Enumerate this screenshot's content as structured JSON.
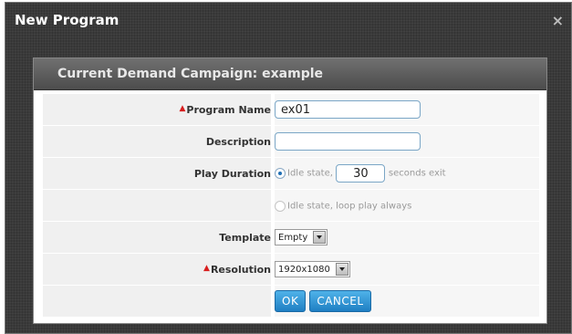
{
  "dialog": {
    "title": "New Program",
    "close_label": "×"
  },
  "panel": {
    "title": "Current Demand Campaign: example"
  },
  "form": {
    "required_marker": "▲",
    "program_name_label": "Program Name",
    "program_name_value": "ex01",
    "description_label": "Description",
    "description_value": "",
    "play_duration_label": "Play Duration",
    "idle_state_label": "Idle state,",
    "idle_seconds_value": "30",
    "seconds_exit_label": "seconds exit",
    "loop_play_label": "Idle state, loop play always",
    "template_label": "Template",
    "template_value": "Empty",
    "resolution_label": "Resolution",
    "resolution_value": "1920x1080"
  },
  "buttons": {
    "ok_label": "OK",
    "cancel_label": "CANCEL"
  },
  "colors": {
    "accent": "#1f7fc3",
    "required": "#d81e1e"
  }
}
